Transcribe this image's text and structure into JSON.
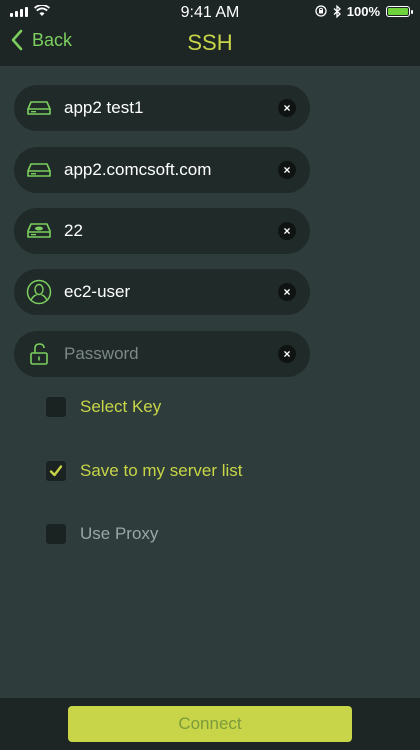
{
  "status_bar": {
    "time": "9:41 AM",
    "battery": "100%",
    "signal_icon": "signal-bars-icon",
    "wifi_icon": "wifi-icon",
    "lock_icon": "rotation-lock-icon",
    "bluetooth_icon": "bluetooth-icon",
    "battery_level": 1.0
  },
  "nav": {
    "back_label": "Back",
    "title": "SSH"
  },
  "fields": {
    "name": {
      "value": "app2 test1",
      "icon": "drive-icon"
    },
    "host": {
      "value": "app2.comcsoft.com",
      "icon": "drive-icon"
    },
    "port": {
      "value": "22",
      "icon": "port-drive-icon"
    },
    "user": {
      "value": "ec2-user",
      "icon": "user-icon"
    },
    "password": {
      "placeholder": "Password",
      "icon": "lock-icon"
    }
  },
  "options": {
    "select_key": {
      "label": "Select Key",
      "checked": false
    },
    "save_to_list": {
      "label": "Save to my server list",
      "checked": true
    },
    "use_proxy": {
      "label": "Use Proxy",
      "checked": false
    }
  },
  "footer": {
    "connect_label": "Connect"
  },
  "colors": {
    "background": "#2e3d3b",
    "bar": "#1d2625",
    "field": "#1f2a29",
    "accent_yellow": "#c8d548",
    "accent_green": "#7ccf5e",
    "battery_green": "#6fd13b"
  }
}
